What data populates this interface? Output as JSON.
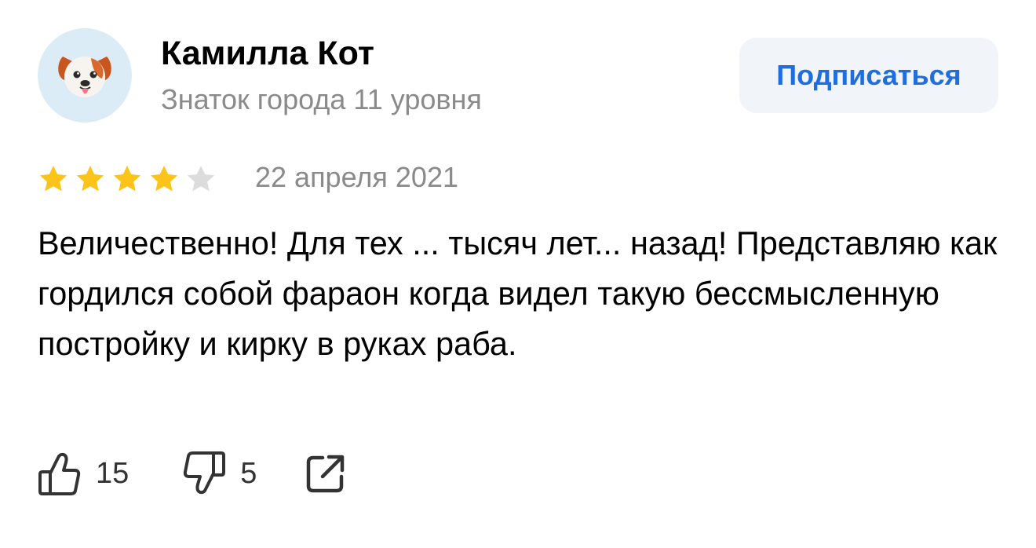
{
  "author": {
    "avatar_icon": "puppy-emoji-icon",
    "name": "Камилла Кот",
    "level": "Знаток города 11 уровня"
  },
  "subscribe": {
    "label": "Подписаться",
    "color": "#1f6ee0"
  },
  "rating": {
    "value": 4,
    "max": 5,
    "filled_color": "#fcc419",
    "empty_color": "#dcdcdc"
  },
  "date": "22 апреля 2021",
  "text": "Величественно! Для тех ... тысяч лет... назад! Представляю как гордился собой фараон когда видел такую бессмысленную постройку и кирку в руках раба.",
  "actions": {
    "like_icon": "thumbs-up-icon",
    "like_count": "15",
    "dislike_icon": "thumbs-down-icon",
    "dislike_count": "5",
    "share_icon": "share-icon"
  }
}
